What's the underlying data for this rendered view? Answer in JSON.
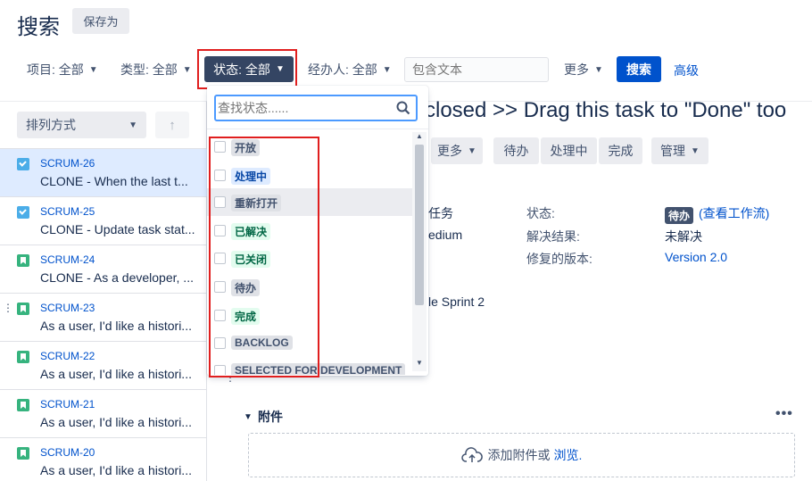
{
  "header": {
    "title": "搜索",
    "save_as": "保存为"
  },
  "filters": {
    "project": "项目: 全部",
    "type": "类型: 全部",
    "status": "状态: 全部",
    "assignee": "经办人: 全部",
    "text_placeholder": "包含文本",
    "more": "更多",
    "search": "搜索",
    "advanced": "高级"
  },
  "left_panel": {
    "order_by": "排列方式",
    "issues": [
      {
        "key": "SCRUM-26",
        "summary": "CLONE - When the last t...",
        "type": "task-icon",
        "selected": true
      },
      {
        "key": "SCRUM-25",
        "summary": "CLONE - Update task stat...",
        "type": "task-icon",
        "selected": false
      },
      {
        "key": "SCRUM-24",
        "summary": "CLONE - As a developer, ...",
        "type": "story-icon",
        "selected": false
      },
      {
        "key": "SCRUM-23",
        "summary": "As a user, I'd like a histori...",
        "type": "story-icon",
        "selected": false
      },
      {
        "key": "SCRUM-22",
        "summary": "As a user, I'd like a histori...",
        "type": "story-icon",
        "selected": false
      },
      {
        "key": "SCRUM-21",
        "summary": "As a user, I'd like a histori...",
        "type": "story-icon",
        "selected": false
      },
      {
        "key": "SCRUM-20",
        "summary": "As a user, I'd like a histori...",
        "type": "story-icon",
        "selected": false
      }
    ]
  },
  "detail": {
    "title": "closed >> Drag this task to \"Done\" too",
    "toolbar": {
      "more": "更多",
      "todo": "待办",
      "in_progress": "处理中",
      "done": "完成",
      "manage": "管理"
    },
    "fields": {
      "type_value_partial": "任务",
      "priority_value_partial": "edium",
      "sprint_value_partial": "le Sprint 2",
      "status_label": "状态:",
      "status_value": "待办",
      "view_workflow": "(查看工作流)",
      "resolution_label": "解决结果:",
      "resolution_value": "未解决",
      "fix_version_label": "修复的版本:",
      "fix_version_value": "Version 2.0"
    },
    "attachments": {
      "title": "附件",
      "drop_text": "添加附件或",
      "browse": "浏览."
    }
  },
  "status_dropdown": {
    "search_placeholder": "查找状态......",
    "options": [
      {
        "label": "开放",
        "color": "grey"
      },
      {
        "label": "处理中",
        "color": "blue"
      },
      {
        "label": "重新打开",
        "color": "grey"
      },
      {
        "label": "已解决",
        "color": "green"
      },
      {
        "label": "已关闭",
        "color": "green"
      },
      {
        "label": "待办",
        "color": "grey"
      },
      {
        "label": "完成",
        "color": "green"
      },
      {
        "label": "BACKLOG",
        "color": "grey"
      },
      {
        "label": "SELECTED FOR DEVELOPMENT",
        "color": "grey"
      }
    ]
  },
  "colors": {
    "primary": "#0052cc",
    "dark_button": "#344563",
    "highlight_red": "#e01e1e"
  }
}
